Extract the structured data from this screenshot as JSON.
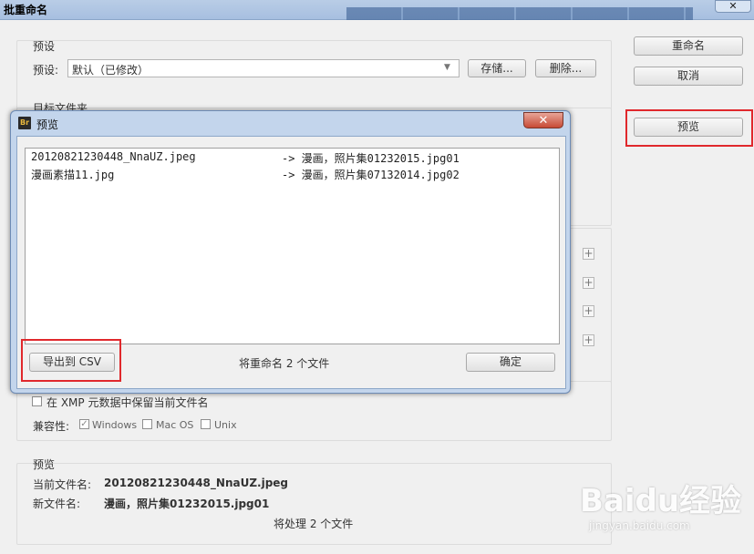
{
  "window": {
    "title": "批重命名",
    "close_label": "✕"
  },
  "preset": {
    "group_title": "预设",
    "label": "预设:",
    "value": "默认（已修改）",
    "save_button": "存储...",
    "delete_button": "删除..."
  },
  "target_folder": {
    "group_title": "目标文件夹"
  },
  "side_buttons": {
    "rename": "重命名",
    "cancel": "取消",
    "preview": "预览"
  },
  "options": {
    "xmp_label": "在 XMP 元数据中保留当前文件名",
    "compat_label": "兼容性:",
    "windows": "Windows",
    "macos": "Mac OS",
    "unix": "Unix",
    "windows_checked": true
  },
  "preview_section": {
    "title": "预览",
    "current_label": "当前文件名:",
    "current_value": "20120821230448_NnaUZ.jpeg",
    "new_label": "新文件名:",
    "new_value": "漫画，照片集01232015.jpg01",
    "count_text": "将处理 2 个文件"
  },
  "dialog": {
    "logo": "Br",
    "title": "预览",
    "close_label": "✕",
    "rows": [
      {
        "src": "20120821230448_NnaUZ.jpeg",
        "dst": "-> 漫画，照片集01232015.jpg01"
      },
      {
        "src": "漫画素描11.jpg",
        "dst": "-> 漫画，照片集07132014.jpg02"
      }
    ],
    "export_button": "导出到 CSV",
    "status": "将重命名 2 个文件",
    "ok_button": "确定"
  },
  "watermark": {
    "brand": "Baidu经验",
    "url": "jingyan.baidu.com"
  }
}
